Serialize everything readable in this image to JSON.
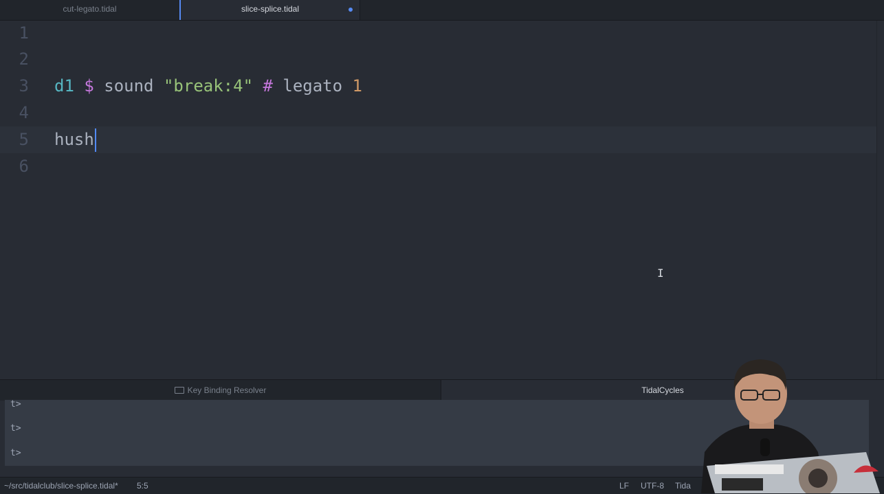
{
  "tabs": [
    {
      "label": "cut-legato.tidal",
      "active": false
    },
    {
      "label": "slice-splice.tidal",
      "active": true,
      "modified": true
    }
  ],
  "editor": {
    "lines": [
      {
        "number": "1",
        "tokens": []
      },
      {
        "number": "2",
        "tokens": []
      },
      {
        "number": "3",
        "tokens": [
          {
            "text": "d1",
            "kind": "d1"
          },
          {
            "text": " ",
            "kind": "ws"
          },
          {
            "text": "$",
            "kind": "op"
          },
          {
            "text": " sound ",
            "kind": "fn"
          },
          {
            "text": "\"break:4\"",
            "kind": "str"
          },
          {
            "text": " ",
            "kind": "ws"
          },
          {
            "text": "#",
            "kind": "op"
          },
          {
            "text": " legato ",
            "kind": "fn"
          },
          {
            "text": "1",
            "kind": "num"
          }
        ]
      },
      {
        "number": "4",
        "tokens": []
      },
      {
        "number": "5",
        "tokens": [
          {
            "text": "hush",
            "kind": "fn"
          }
        ],
        "cursor": true
      },
      {
        "number": "6",
        "tokens": []
      }
    ]
  },
  "panel": {
    "tabs": [
      {
        "label": "Key Binding Resolver",
        "icon": "keyboard-icon"
      },
      {
        "label": "TidalCycles"
      }
    ],
    "console_lines": [
      "t>",
      "t>",
      "t>"
    ]
  },
  "status": {
    "file_path": "~/src/tidalclub/slice-splice.tidal*",
    "cursor_position": "5:5",
    "line_ending": "LF",
    "encoding": "UTF-8",
    "grammar": "Tida"
  },
  "colors": {
    "accent": "#568af2",
    "background": "#282c34",
    "panel": "#21252b"
  }
}
